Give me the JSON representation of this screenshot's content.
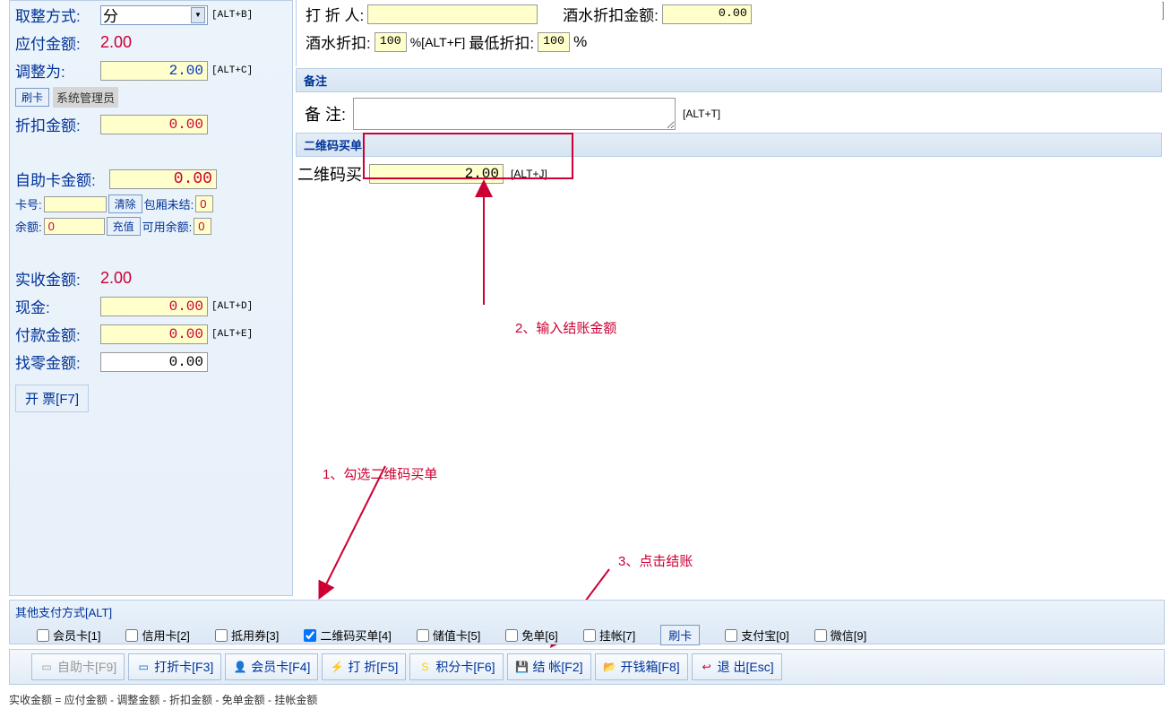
{
  "left": {
    "rounding_label": "取整方式:",
    "rounding_value": "分",
    "rounding_hotkey": "[ALT+B]",
    "payable_label": "应付金额:",
    "payable_value": "2.00",
    "adjust_label": "调整为:",
    "adjust_value": "2.00",
    "adjust_hotkey": "[ALT+C]",
    "swipe_card": "刷卡",
    "sys_admin": "系统管理员",
    "discount_amt_label": "折扣金额:",
    "discount_amt_value": "0.00",
    "selfcard_label": "自助卡金额:",
    "selfcard_value": "0.00",
    "cardno_label": "卡号:",
    "clear_btn": "清除",
    "room_unpaid_label": "包厢未结:",
    "room_unpaid_value": "0",
    "balance_label": "余额:",
    "balance_value": "0",
    "recharge_btn": "充值",
    "available_label": "可用余额:",
    "available_value": "0",
    "received_label": "实收金额:",
    "received_value": "2.00",
    "cash_label": "现金:",
    "cash_value": "0.00",
    "cash_hotkey": "[ALT+D]",
    "payment_label": "付款金额:",
    "payment_value": "0.00",
    "payment_hotkey": "[ALT+E]",
    "change_label": "找零金额:",
    "change_value": "0.00",
    "invoice_btn": "开 票[F7]"
  },
  "top": {
    "discounter_label": "打 折 人:",
    "wine_discount_amt_label": "酒水折扣金额:",
    "wine_discount_amt_value": "0.00",
    "wine_discount_label": "酒水折扣:",
    "wine_discount_value": "100",
    "wine_discount_hotkey": "%[ALT+F]",
    "min_discount_label": "最低折扣:",
    "min_discount_value": "100",
    "percent": "%"
  },
  "remark": {
    "header": "备注",
    "label": "备  注:",
    "hotkey": "[ALT+T]"
  },
  "qr": {
    "header": "二维码买单",
    "label": "二维码买",
    "value": "2.00",
    "hotkey": "[ALT+J]"
  },
  "annotations": {
    "step1": "1、勾选二维码买单",
    "step2": "2、输入结账金额",
    "step3": "3、点击结账"
  },
  "payment_methods": {
    "title": "其他支付方式[ALT]",
    "items": [
      {
        "label": "会员卡[1]",
        "checked": false
      },
      {
        "label": "信用卡[2]",
        "checked": false
      },
      {
        "label": "抵用券[3]",
        "checked": false
      },
      {
        "label": "二维码买单[4]",
        "checked": true
      },
      {
        "label": "储值卡[5]",
        "checked": false
      },
      {
        "label": "免单[6]",
        "checked": false
      },
      {
        "label": "挂帐[7]",
        "checked": false
      }
    ],
    "swipe_btn": "刷卡",
    "extra": [
      {
        "label": "支付宝[0]",
        "checked": false
      },
      {
        "label": "微信[9]",
        "checked": false
      }
    ]
  },
  "bottom_buttons": {
    "selfcard": "自助卡[F9]",
    "discount_card": "打折卡[F3]",
    "member_card": "会员卡[F4]",
    "discount": "打 折[F5]",
    "points_card": "积分卡[F6]",
    "checkout": "结  帐[F2]",
    "cashbox": "开钱箱[F8]",
    "exit": "退 出[Esc]"
  },
  "status": "实收金额 = 应付金额 - 调整金额 - 折扣金额 - 免单金额 - 挂帐金额"
}
